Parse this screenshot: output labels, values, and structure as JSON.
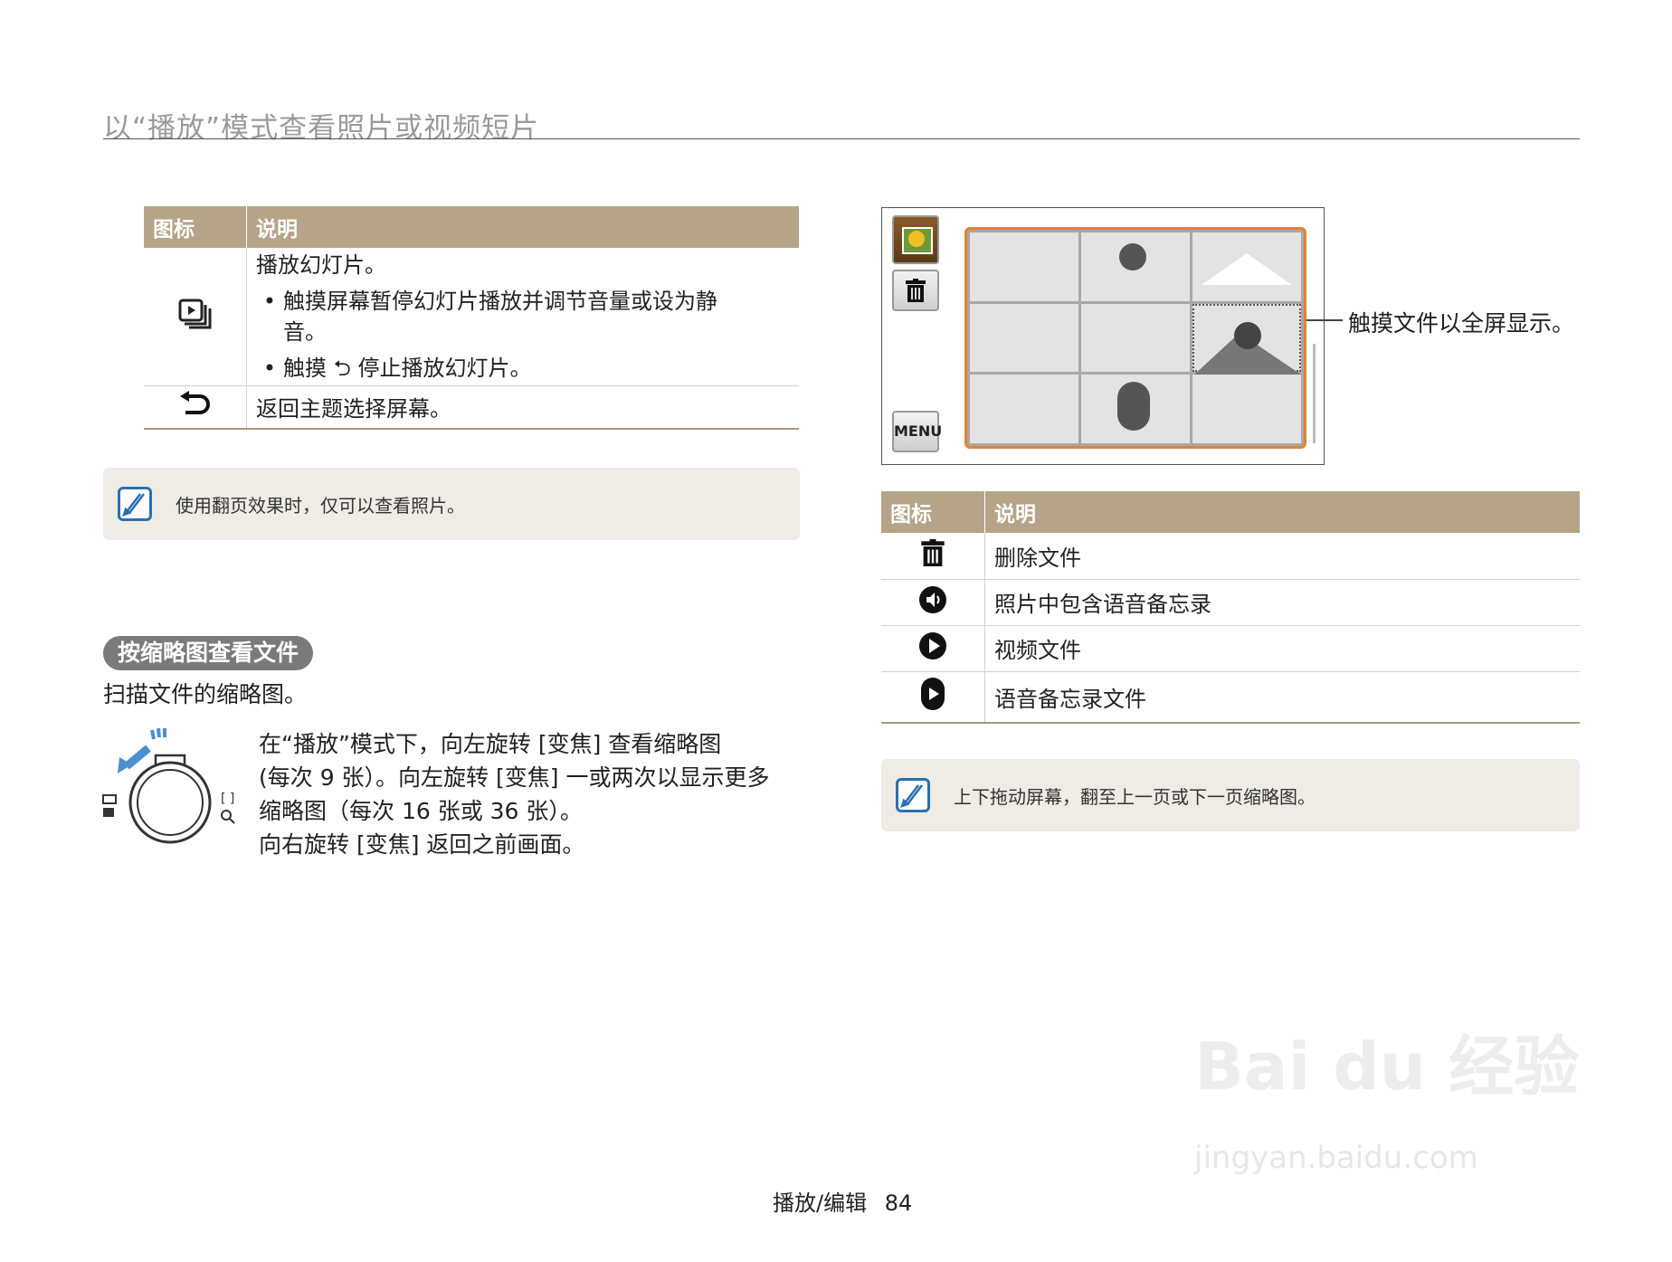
{
  "header": {
    "title": "以“播放”模式查看照片或视频短片"
  },
  "left_table": {
    "col_icon": "图标",
    "col_desc": "说明",
    "rows": [
      {
        "icon": "slideshow-icon",
        "lines": [
          "播放幻灯片。"
        ],
        "bullets": [
          "触摸屏幕暂停幻灯片播放并调节音量或设为静音。",
          "触摸 ⮌ 停止播放幻灯片。"
        ]
      },
      {
        "icon": "back-icon",
        "lines": [
          "返回主题选择屏幕。"
        ],
        "bullets": []
      }
    ]
  },
  "note1": {
    "text": "使用翻页效果时，仅可以查看照片。"
  },
  "section": {
    "title": "按缩略图查看文件",
    "intro": "扫描文件的缩略图。",
    "paragraph": [
      "在“播放”模式下，向左旋转 [变焦] 查看缩略图",
      "(每次 9 张）。向左旋转 [变焦] 一或两次以显示更多",
      "缩略图（每次 16 张或 36 张）。",
      "向右旋转 [变焦] 返回之前画面。"
    ]
  },
  "screen": {
    "menu_label": "MENU",
    "callout": "触摸文件以全屏显示。"
  },
  "right_table": {
    "col_icon": "图标",
    "col_desc": "说明",
    "rows": [
      {
        "icon": "trash-icon",
        "text": "删除文件"
      },
      {
        "icon": "voice-memo-icon",
        "text": "照片中包含语音备忘录"
      },
      {
        "icon": "video-icon",
        "text": "视频文件"
      },
      {
        "icon": "voice-file-icon",
        "text": "语音备忘录文件"
      }
    ]
  },
  "note2": {
    "text": "上下拖动屏幕，翻至上一页或下一页缩略图。"
  },
  "footer": {
    "section": "播放/编辑",
    "page": "84"
  },
  "watermark": {
    "brand": "Bai du 经验",
    "url": "jingyan.baidu.com"
  }
}
